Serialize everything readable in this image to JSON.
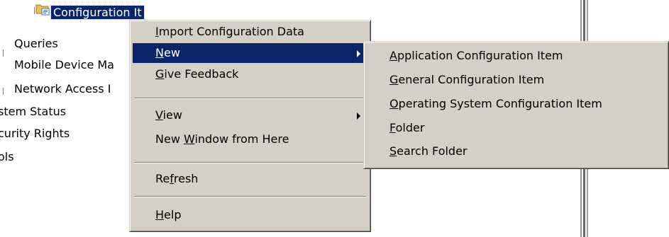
{
  "tree": {
    "items": [
      {
        "label": "Configuration It"
      },
      {
        "label": "Queries"
      },
      {
        "label": "Mobile Device Ma"
      },
      {
        "label": "Network Access I"
      },
      {
        "label": "stem Status"
      },
      {
        "label": "curity Rights"
      },
      {
        "label": "ols"
      }
    ]
  },
  "context_menu": {
    "items": [
      {
        "pre": "",
        "key": "I",
        "post": "mport Configuration Data"
      },
      {
        "pre": "",
        "key": "N",
        "post": "ew"
      },
      {
        "pre": "",
        "key": "G",
        "post": "ive Feedback"
      },
      {
        "pre": "",
        "key": "V",
        "post": "iew"
      },
      {
        "pre": "New ",
        "key": "W",
        "post": "indow from Here"
      },
      {
        "pre": "Re",
        "key": "f",
        "post": "resh"
      },
      {
        "pre": "",
        "key": "H",
        "post": "elp"
      }
    ]
  },
  "submenu": {
    "items": [
      {
        "key": "A",
        "post": "pplication Configuration Item"
      },
      {
        "key": "G",
        "post": "eneral Configuration Item"
      },
      {
        "key": "O",
        "post": "perating System Configuration Item"
      },
      {
        "key": "F",
        "post": "older"
      },
      {
        "key": "S",
        "post": "earch Folder"
      }
    ]
  },
  "colors": {
    "menu_background": "#d4d0c8",
    "highlight": "#0a246a",
    "highlight_text": "#ffffff"
  },
  "icons": {
    "tree_selected": "folder-config-icon",
    "submenu_arrow": "submenu-arrow-icon"
  }
}
